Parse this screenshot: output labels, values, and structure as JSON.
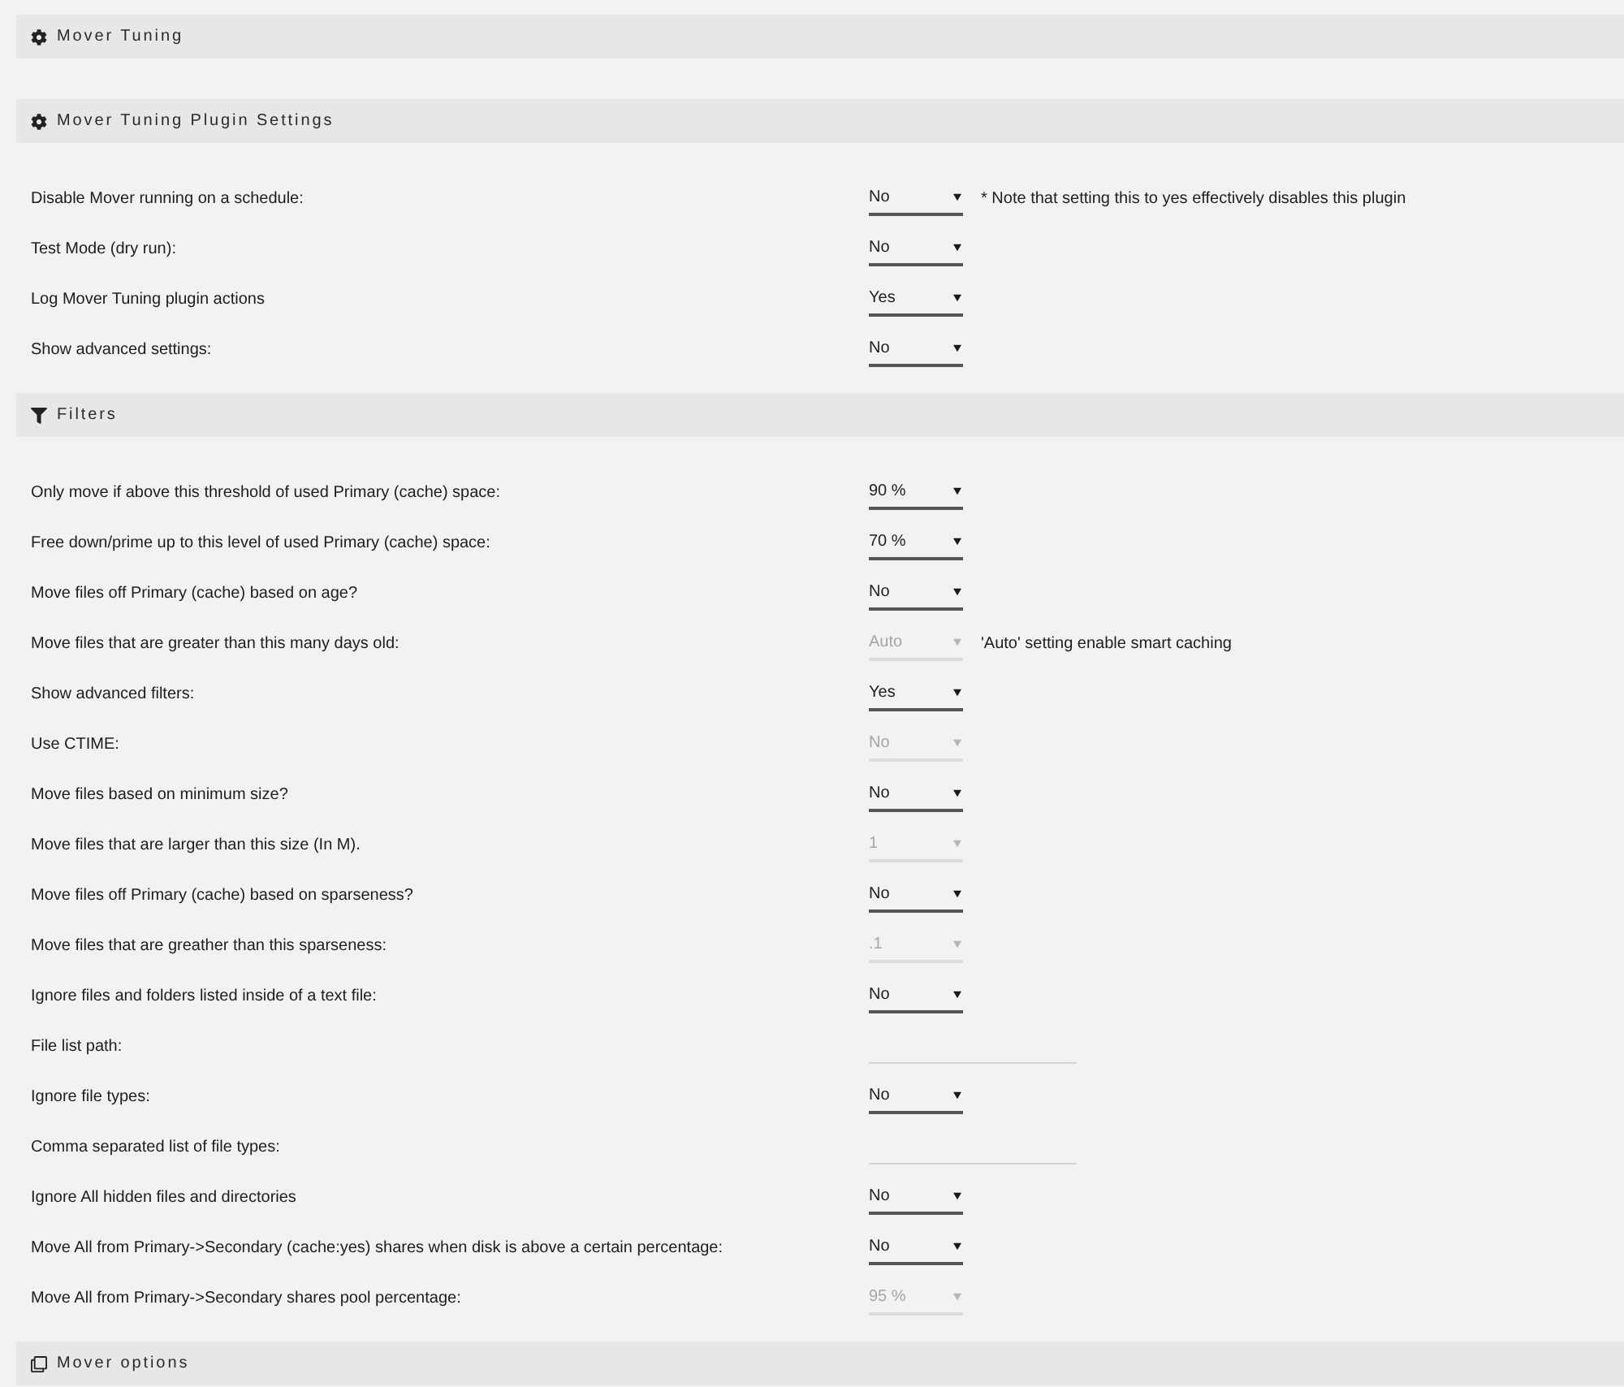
{
  "sections": [
    {
      "title": "Mover Tuning"
    },
    {
      "title": "Mover Tuning Plugin Settings",
      "rows": [
        {
          "label": "Disable Mover running on a schedule:",
          "kind": "select",
          "value": "No",
          "disabled": false,
          "note": "* Note that setting this to yes effectively disables this plugin"
        },
        {
          "label": "Test Mode (dry run):",
          "kind": "select",
          "value": "No",
          "disabled": false
        },
        {
          "label": "Log Mover Tuning plugin actions",
          "kind": "select",
          "value": "Yes",
          "disabled": false
        },
        {
          "label": "Show advanced settings:",
          "kind": "select",
          "value": "No",
          "disabled": false
        }
      ]
    },
    {
      "title": "Filters",
      "rows": [
        {
          "label": "Only move if above this threshold of used Primary (cache) space:",
          "kind": "select",
          "value": "90 %",
          "disabled": false
        },
        {
          "label": "Free down/prime up to this level of used Primary (cache) space:",
          "kind": "select",
          "value": "70 %",
          "disabled": false
        },
        {
          "label": "Move files off Primary (cache) based on age?",
          "kind": "select",
          "value": "No",
          "disabled": false
        },
        {
          "label": "Move files that are greater than this many days old:",
          "kind": "select",
          "value": "Auto",
          "disabled": true,
          "note": "'Auto' setting enable smart caching"
        },
        {
          "label": "Show advanced filters:",
          "kind": "select",
          "value": "Yes",
          "disabled": false
        },
        {
          "label": "Use CTIME:",
          "kind": "select",
          "value": "No",
          "disabled": true
        },
        {
          "label": "Move files based on minimum size?",
          "kind": "select",
          "value": "No",
          "disabled": false
        },
        {
          "label": "Move files that are larger than this size (In M).",
          "kind": "select",
          "value": "1",
          "disabled": true
        },
        {
          "label": "Move files off Primary (cache) based on sparseness?",
          "kind": "select",
          "value": "No",
          "disabled": false
        },
        {
          "label": "Move files that are greather than this sparseness:",
          "kind": "select",
          "value": ".1",
          "disabled": true
        },
        {
          "label": "Ignore files and folders listed inside of a text file:",
          "kind": "select",
          "value": "No",
          "disabled": false
        },
        {
          "label": "File list path:",
          "kind": "text"
        },
        {
          "label": "Ignore file types:",
          "kind": "select",
          "value": "No",
          "disabled": false
        },
        {
          "label": "Comma separated list of file types:",
          "kind": "text"
        },
        {
          "label": "Ignore All hidden files and directories",
          "kind": "select",
          "value": "No",
          "disabled": false
        },
        {
          "label": "Move All from Primary->Secondary (cache:yes) shares when disk is above a certain percentage:",
          "kind": "select",
          "value": "No",
          "disabled": false
        },
        {
          "label": "Move All from Primary->Secondary shares pool percentage:",
          "kind": "select",
          "value": "95 %",
          "disabled": true
        }
      ]
    },
    {
      "title": "Mover options"
    }
  ]
}
